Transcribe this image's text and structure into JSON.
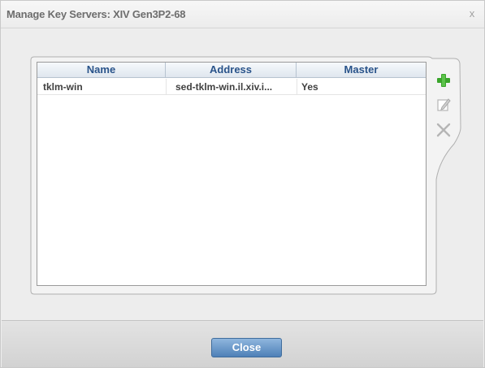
{
  "dialog": {
    "title": "Manage Key Servers: XIV Gen3P2-68",
    "close_glyph": "x"
  },
  "table": {
    "columns": [
      "Name",
      "Address",
      "Master"
    ],
    "rows": [
      {
        "name": "tklm-win",
        "address": "sed-tklm-win.il.xiv.i...",
        "master": "Yes"
      }
    ]
  },
  "toolbar": {
    "add_icon": "plus-icon",
    "edit_icon": "edit-icon",
    "delete_icon": "delete-icon",
    "add_color": "#3aa52b",
    "disabled_color": "#b5b5b5"
  },
  "footer": {
    "close_label": "Close"
  },
  "colors": {
    "header_text": "#29538a",
    "button_blue": "#4e80b7"
  }
}
